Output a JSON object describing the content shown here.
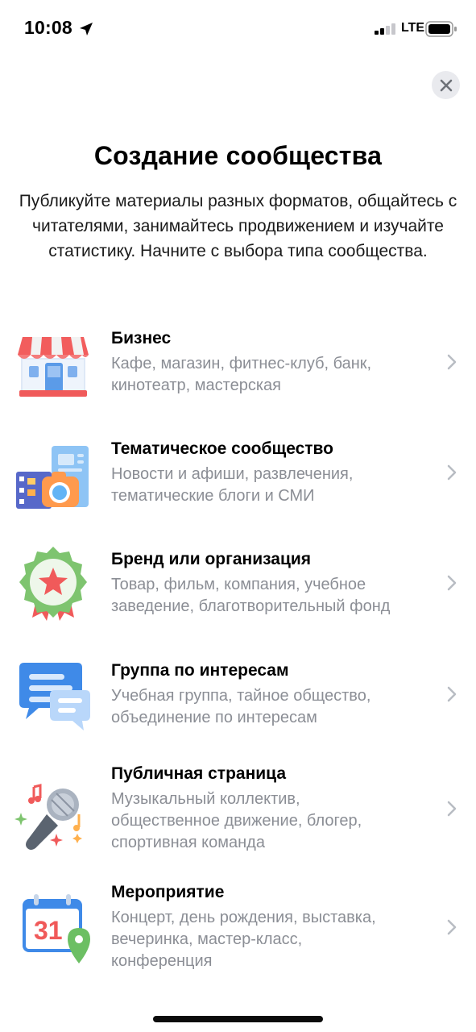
{
  "status_bar": {
    "time": "10:08",
    "network": "LTE"
  },
  "title": "Создание сообщества",
  "subtitle": "Публикуйте материалы разных форматов, общайтесь с читателями, занимайтесь продвижением и изучайте статистику. Начните с выбора типа сообщества.",
  "types": [
    {
      "title": "Бизнес",
      "description": "Кафе, магазин, фитнес-клуб, банк,\nкинотеатр, мастерская",
      "icon": "store-icon"
    },
    {
      "title": "Тематическое сообщество",
      "description": "Новости и афиши, развлечения,\nтематические блоги и СМИ",
      "icon": "media-camera-icon"
    },
    {
      "title": "Бренд или организация",
      "description": "Товар, фильм, компания, учебное\nзаведение, благотворительный фонд",
      "icon": "award-badge-icon"
    },
    {
      "title": "Группа по интересам",
      "description": "Учебная группа, тайное общество,\nобъединение по интересам",
      "icon": "chat-bubbles-icon"
    },
    {
      "title": "Публичная страница",
      "description": "Музыкальный коллектив,\nобщественное движение, блогер,\nспортивная команда",
      "icon": "microphone-icon"
    },
    {
      "title": "Мероприятие",
      "description": "Концерт, день рождения, выставка,\nвечеринка, мастер-класс,\nконференция",
      "icon": "calendar-pin-icon",
      "calendar_day": "31"
    }
  ]
}
